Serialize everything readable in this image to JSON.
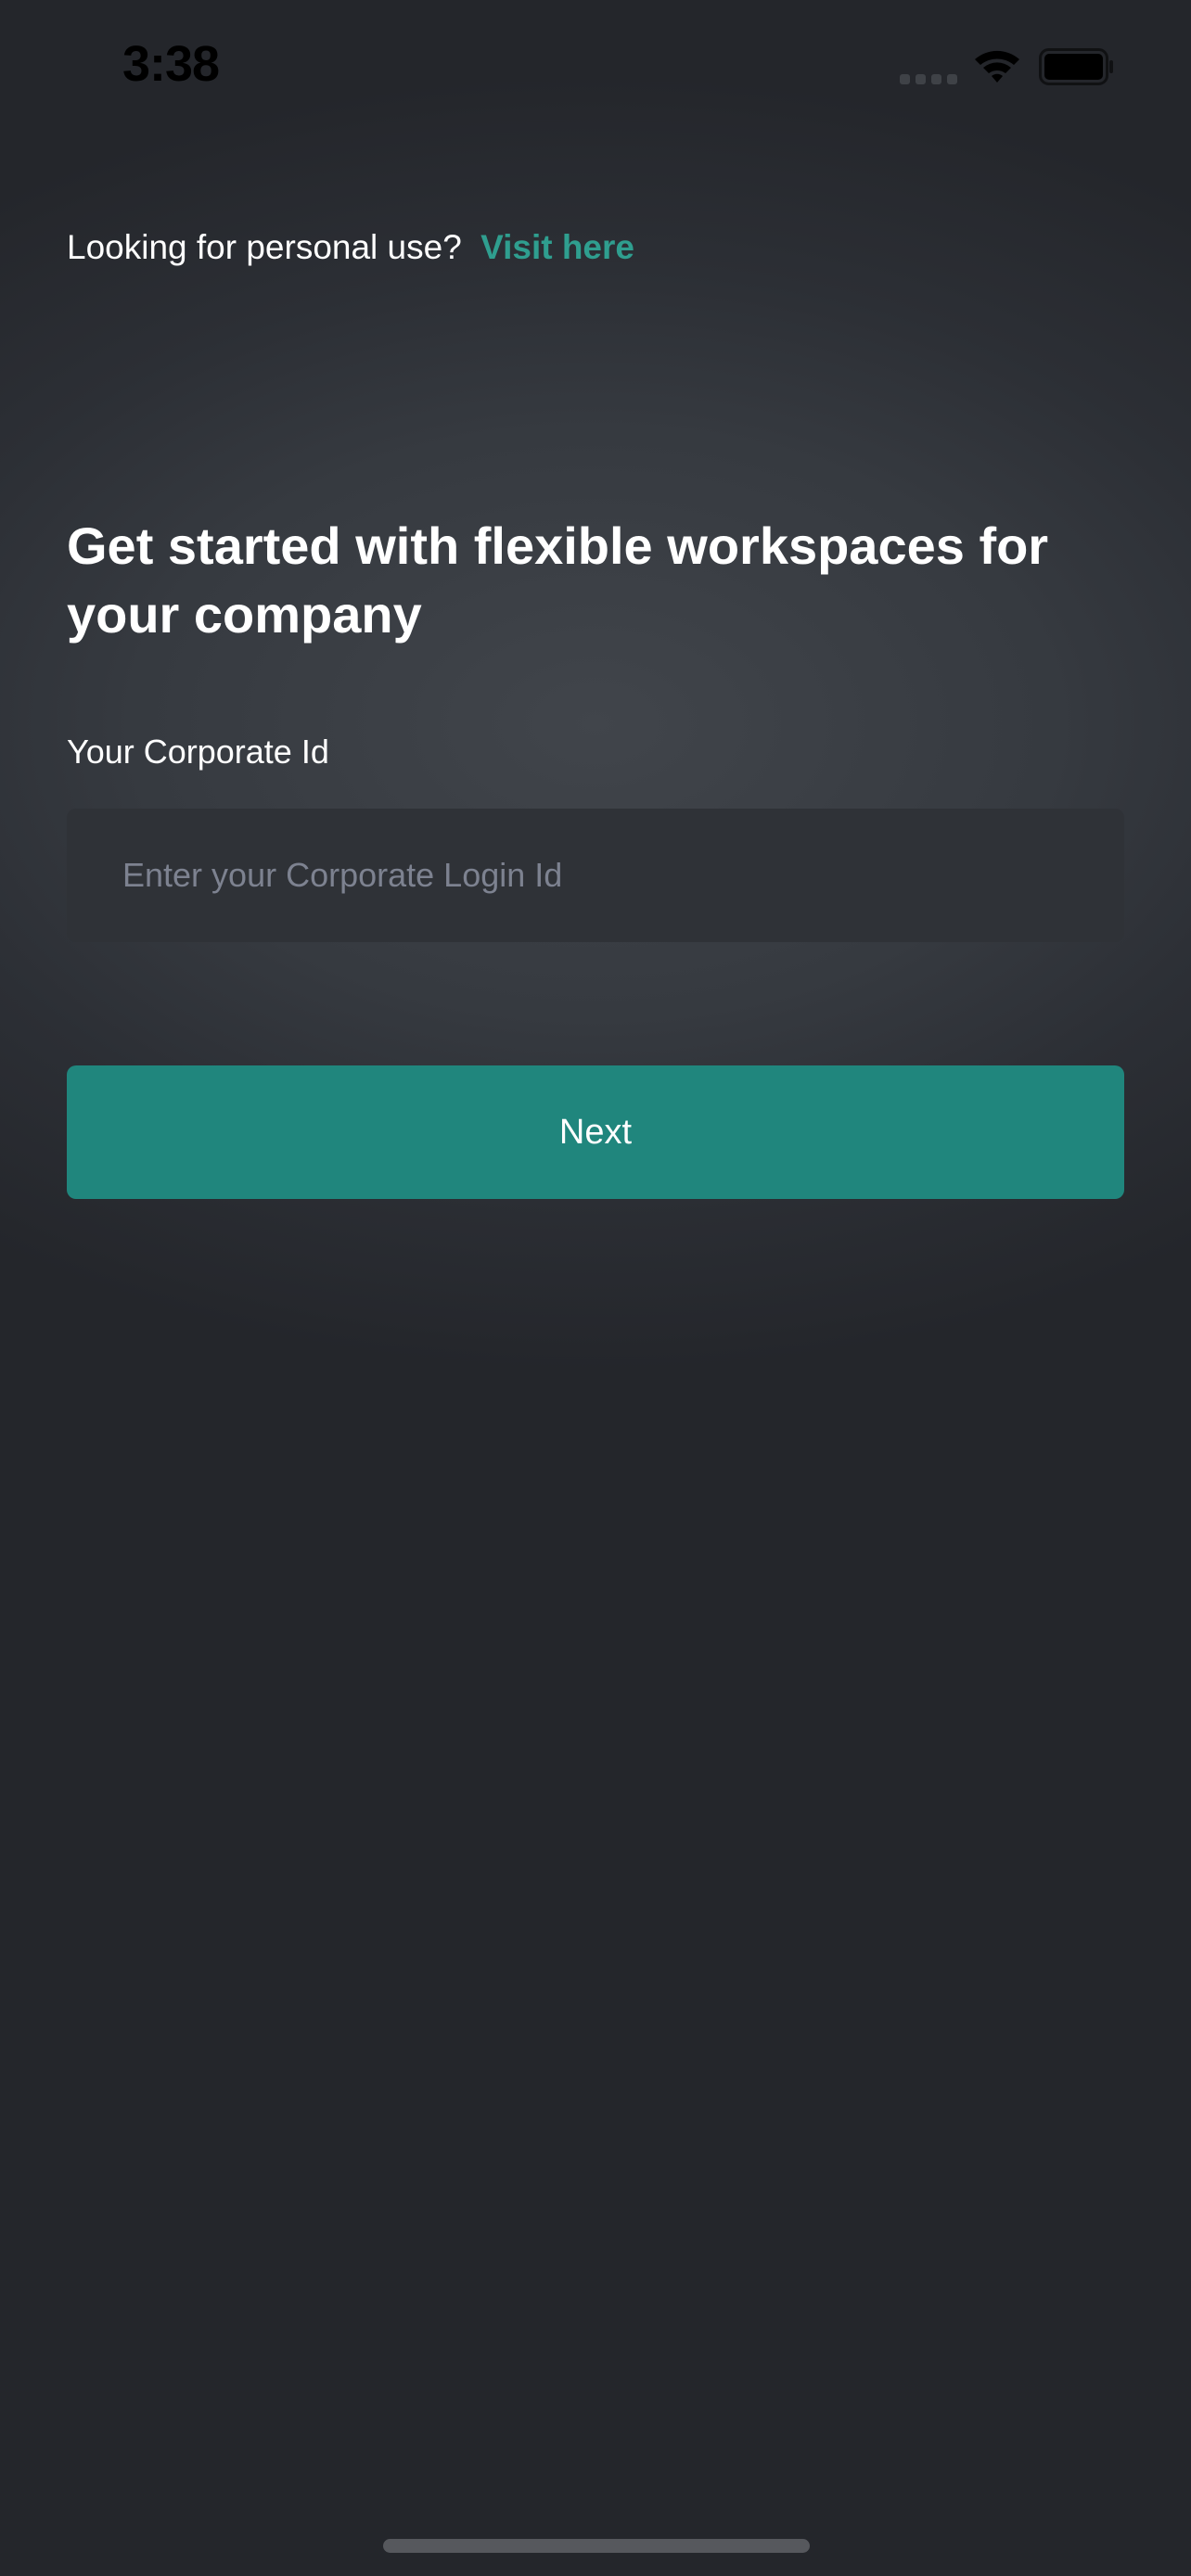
{
  "status_bar": {
    "time": "3:38",
    "icons": [
      "signal-icon",
      "wifi-icon",
      "battery-icon"
    ]
  },
  "personal": {
    "prompt": "Looking for personal use?",
    "link_label": "Visit here"
  },
  "title": "Get started with flexible workspaces for your company",
  "corporate_field": {
    "label": "Your Corporate Id",
    "value": "",
    "placeholder": "Enter your Corporate Login Id"
  },
  "next_button": {
    "label": "Next"
  },
  "colors": {
    "accent": "#20867d",
    "link": "#2f9e8f",
    "background": "#2c2f35",
    "input_background": "#2f3237",
    "placeholder": "#7d8290"
  }
}
